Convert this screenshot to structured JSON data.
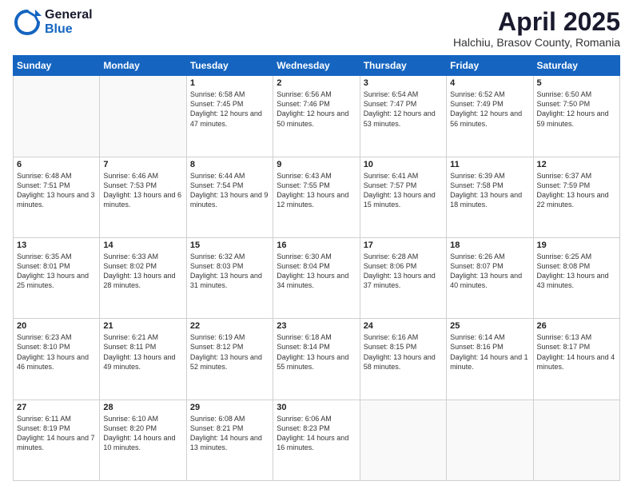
{
  "logo": {
    "general": "General",
    "blue": "Blue"
  },
  "header": {
    "month": "April 2025",
    "location": "Halchiu, Brasov County, Romania"
  },
  "weekdays": [
    "Sunday",
    "Monday",
    "Tuesday",
    "Wednesday",
    "Thursday",
    "Friday",
    "Saturday"
  ],
  "weeks": [
    [
      {
        "day": "",
        "info": ""
      },
      {
        "day": "",
        "info": ""
      },
      {
        "day": "1",
        "info": "Sunrise: 6:58 AM\nSunset: 7:45 PM\nDaylight: 12 hours and 47 minutes."
      },
      {
        "day": "2",
        "info": "Sunrise: 6:56 AM\nSunset: 7:46 PM\nDaylight: 12 hours and 50 minutes."
      },
      {
        "day": "3",
        "info": "Sunrise: 6:54 AM\nSunset: 7:47 PM\nDaylight: 12 hours and 53 minutes."
      },
      {
        "day": "4",
        "info": "Sunrise: 6:52 AM\nSunset: 7:49 PM\nDaylight: 12 hours and 56 minutes."
      },
      {
        "day": "5",
        "info": "Sunrise: 6:50 AM\nSunset: 7:50 PM\nDaylight: 12 hours and 59 minutes."
      }
    ],
    [
      {
        "day": "6",
        "info": "Sunrise: 6:48 AM\nSunset: 7:51 PM\nDaylight: 13 hours and 3 minutes."
      },
      {
        "day": "7",
        "info": "Sunrise: 6:46 AM\nSunset: 7:53 PM\nDaylight: 13 hours and 6 minutes."
      },
      {
        "day": "8",
        "info": "Sunrise: 6:44 AM\nSunset: 7:54 PM\nDaylight: 13 hours and 9 minutes."
      },
      {
        "day": "9",
        "info": "Sunrise: 6:43 AM\nSunset: 7:55 PM\nDaylight: 13 hours and 12 minutes."
      },
      {
        "day": "10",
        "info": "Sunrise: 6:41 AM\nSunset: 7:57 PM\nDaylight: 13 hours and 15 minutes."
      },
      {
        "day": "11",
        "info": "Sunrise: 6:39 AM\nSunset: 7:58 PM\nDaylight: 13 hours and 18 minutes."
      },
      {
        "day": "12",
        "info": "Sunrise: 6:37 AM\nSunset: 7:59 PM\nDaylight: 13 hours and 22 minutes."
      }
    ],
    [
      {
        "day": "13",
        "info": "Sunrise: 6:35 AM\nSunset: 8:01 PM\nDaylight: 13 hours and 25 minutes."
      },
      {
        "day": "14",
        "info": "Sunrise: 6:33 AM\nSunset: 8:02 PM\nDaylight: 13 hours and 28 minutes."
      },
      {
        "day": "15",
        "info": "Sunrise: 6:32 AM\nSunset: 8:03 PM\nDaylight: 13 hours and 31 minutes."
      },
      {
        "day": "16",
        "info": "Sunrise: 6:30 AM\nSunset: 8:04 PM\nDaylight: 13 hours and 34 minutes."
      },
      {
        "day": "17",
        "info": "Sunrise: 6:28 AM\nSunset: 8:06 PM\nDaylight: 13 hours and 37 minutes."
      },
      {
        "day": "18",
        "info": "Sunrise: 6:26 AM\nSunset: 8:07 PM\nDaylight: 13 hours and 40 minutes."
      },
      {
        "day": "19",
        "info": "Sunrise: 6:25 AM\nSunset: 8:08 PM\nDaylight: 13 hours and 43 minutes."
      }
    ],
    [
      {
        "day": "20",
        "info": "Sunrise: 6:23 AM\nSunset: 8:10 PM\nDaylight: 13 hours and 46 minutes."
      },
      {
        "day": "21",
        "info": "Sunrise: 6:21 AM\nSunset: 8:11 PM\nDaylight: 13 hours and 49 minutes."
      },
      {
        "day": "22",
        "info": "Sunrise: 6:19 AM\nSunset: 8:12 PM\nDaylight: 13 hours and 52 minutes."
      },
      {
        "day": "23",
        "info": "Sunrise: 6:18 AM\nSunset: 8:14 PM\nDaylight: 13 hours and 55 minutes."
      },
      {
        "day": "24",
        "info": "Sunrise: 6:16 AM\nSunset: 8:15 PM\nDaylight: 13 hours and 58 minutes."
      },
      {
        "day": "25",
        "info": "Sunrise: 6:14 AM\nSunset: 8:16 PM\nDaylight: 14 hours and 1 minute."
      },
      {
        "day": "26",
        "info": "Sunrise: 6:13 AM\nSunset: 8:17 PM\nDaylight: 14 hours and 4 minutes."
      }
    ],
    [
      {
        "day": "27",
        "info": "Sunrise: 6:11 AM\nSunset: 8:19 PM\nDaylight: 14 hours and 7 minutes."
      },
      {
        "day": "28",
        "info": "Sunrise: 6:10 AM\nSunset: 8:20 PM\nDaylight: 14 hours and 10 minutes."
      },
      {
        "day": "29",
        "info": "Sunrise: 6:08 AM\nSunset: 8:21 PM\nDaylight: 14 hours and 13 minutes."
      },
      {
        "day": "30",
        "info": "Sunrise: 6:06 AM\nSunset: 8:23 PM\nDaylight: 14 hours and 16 minutes."
      },
      {
        "day": "",
        "info": ""
      },
      {
        "day": "",
        "info": ""
      },
      {
        "day": "",
        "info": ""
      }
    ]
  ]
}
